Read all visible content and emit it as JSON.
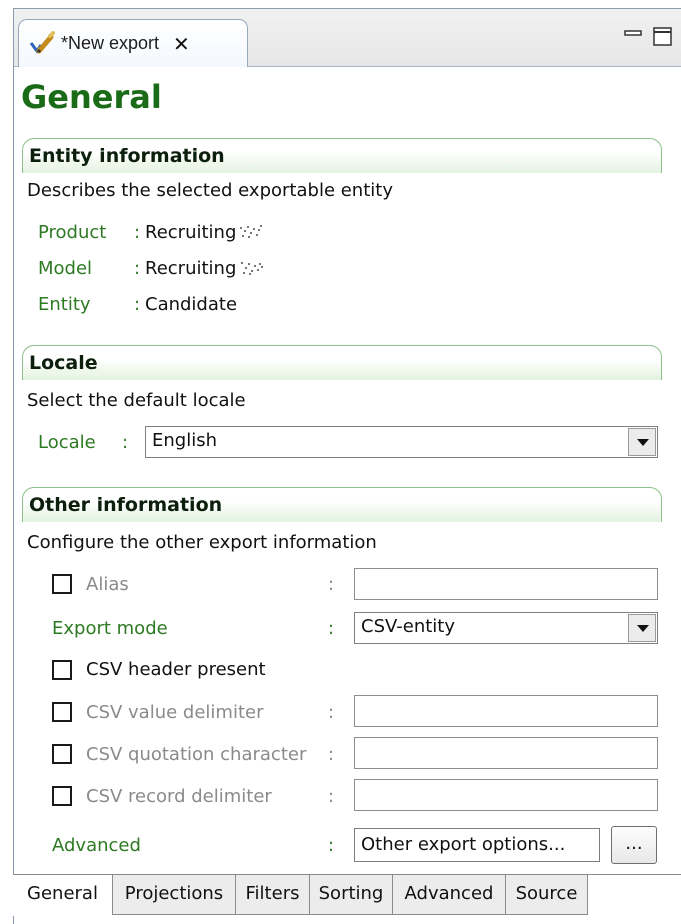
{
  "editor_tab": {
    "title": "*New export",
    "close_glyph": "✕",
    "icon": "pencil-check-icon"
  },
  "window_controls": [
    "minimize-icon",
    "maximize-icon"
  ],
  "page": {
    "title": "General"
  },
  "entity_section": {
    "title": "Entity information",
    "description": "Describes the selected exportable entity",
    "fields": [
      {
        "label": "Product",
        "value": "Recruiting"
      },
      {
        "label": "Model",
        "value": "Recruiting"
      },
      {
        "label": "Entity",
        "value": "Candidate"
      }
    ]
  },
  "locale_section": {
    "title": "Locale",
    "description": "Select the default locale",
    "label": "Locale",
    "selected": "English"
  },
  "other_section": {
    "title": "Other information",
    "description": "Configure the other export information",
    "alias": {
      "label": "Alias",
      "checked": false,
      "value": ""
    },
    "export_mode": {
      "label": "Export mode",
      "selected": "CSV-entity"
    },
    "csv_header": {
      "label": "CSV header present",
      "checked": false
    },
    "value_delimiter": {
      "label": "CSV value delimiter",
      "checked": false,
      "value": ""
    },
    "quotation_char": {
      "label": "CSV quotation character",
      "checked": false,
      "value": ""
    },
    "record_delimiter": {
      "label": "CSV record delimiter",
      "checked": false,
      "value": ""
    },
    "advanced": {
      "label": "Advanced",
      "button": "Other export options...",
      "dots": "..."
    }
  },
  "colon": ":",
  "bottom_tabs": [
    "General",
    "Projections",
    "Filters",
    "Sorting",
    "Advanced",
    "Source"
  ],
  "colors": {
    "title_green": "#1a6b18",
    "label_green": "#2d7a23",
    "section_border": "#8cc08c"
  }
}
